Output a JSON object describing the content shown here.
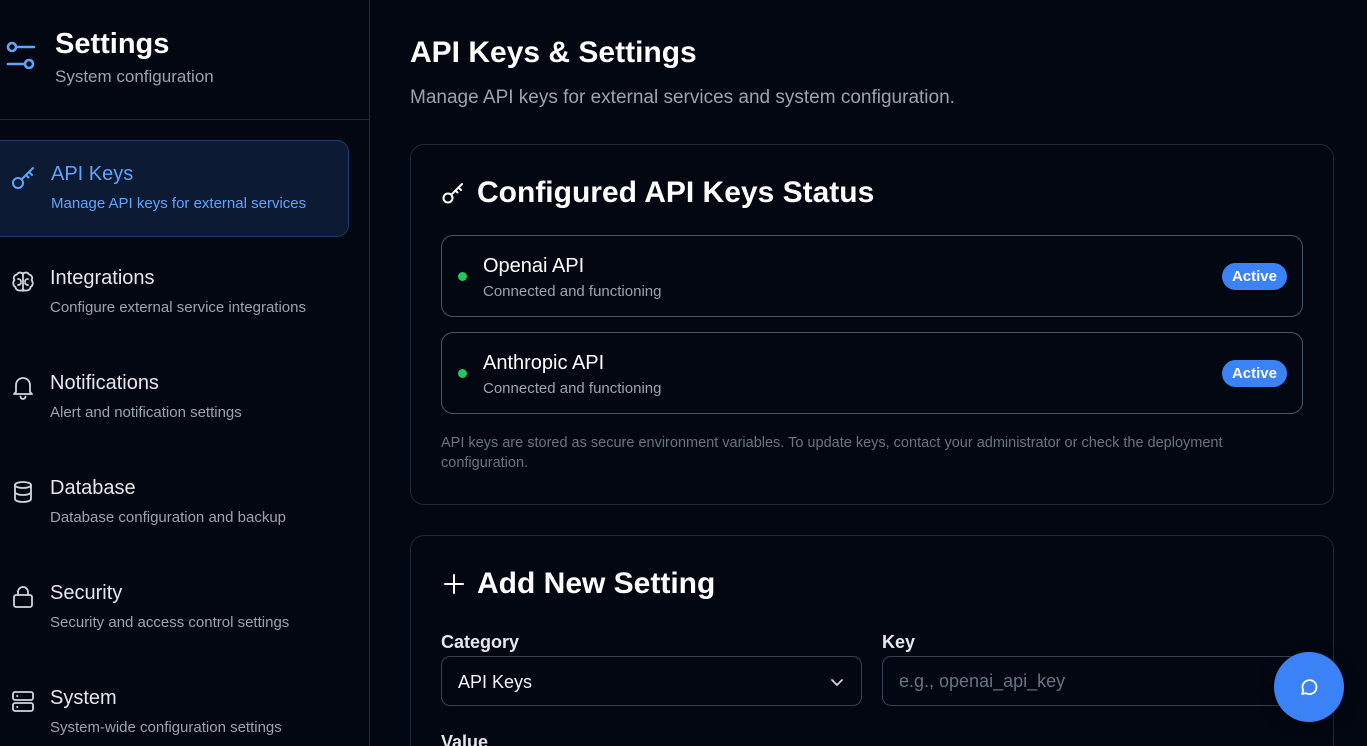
{
  "sidebar": {
    "title": "Settings",
    "subtitle": "System configuration",
    "logo_icon": "sliders-icon",
    "items": [
      {
        "label": "API Keys",
        "desc": "Manage API keys for external services",
        "icon": "key-icon",
        "active": true
      },
      {
        "label": "Integrations",
        "desc": "Configure external service integrations",
        "icon": "brain-icon"
      },
      {
        "label": "Notifications",
        "desc": "Alert and notification settings",
        "icon": "bell-icon"
      },
      {
        "label": "Database",
        "desc": "Database configuration and backup",
        "icon": "database-icon"
      },
      {
        "label": "Security",
        "desc": "Security and access control settings",
        "icon": "lock-icon"
      },
      {
        "label": "System",
        "desc": "System-wide configuration settings",
        "icon": "server-icon"
      }
    ]
  },
  "main": {
    "title": "API Keys & Settings",
    "subtitle": "Manage API keys for external services and system configuration.",
    "status_card": {
      "title": "Configured API Keys Status",
      "keys": [
        {
          "name": "Openai API",
          "status": "Connected and functioning",
          "badge": "Active"
        },
        {
          "name": "Anthropic API",
          "status": "Connected and functioning",
          "badge": "Active"
        }
      ],
      "note": "API keys are stored as secure environment variables. To update keys, contact your administrator or check the deployment configuration."
    },
    "add_card": {
      "title": "Add New Setting",
      "category_label": "Category",
      "category_value": "API Keys",
      "key_label": "Key",
      "key_placeholder": "e.g., openai_api_key",
      "value_label": "Value"
    }
  },
  "colors": {
    "background": "#030712",
    "accent": "#3b82f6",
    "active_text": "#60a5fa",
    "status_ok": "#22c55e"
  }
}
